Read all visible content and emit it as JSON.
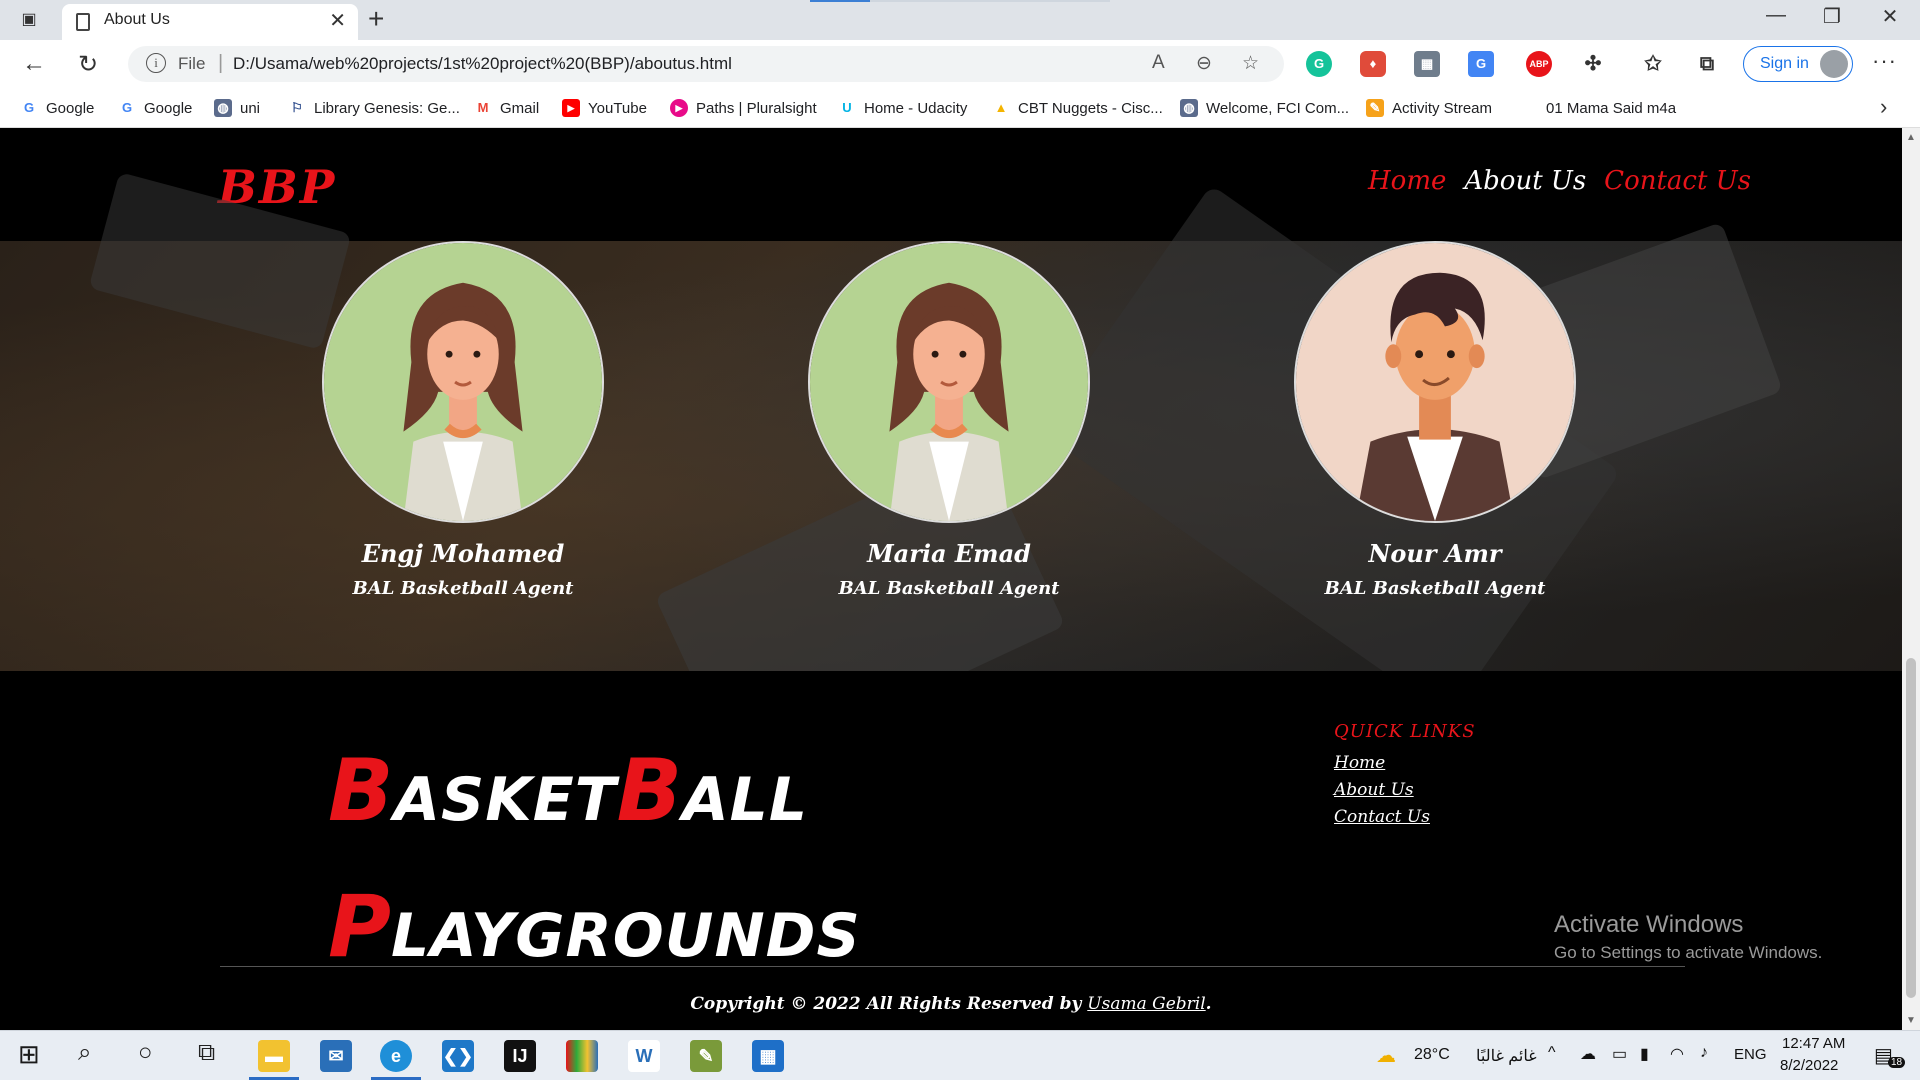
{
  "browser": {
    "tab_title": "About Us",
    "url_scheme_label": "File",
    "url": "D:/Usama/web%20projects/1st%20project%20(BBP)/aboutus.html",
    "signin_label": "Sign in",
    "bookmarks": [
      {
        "label": "Google",
        "icon": "google-icon",
        "color": "#4285f4"
      },
      {
        "label": "Google",
        "icon": "google-icon",
        "color": "#4285f4"
      },
      {
        "label": "uni",
        "icon": "globe-icon",
        "color": "#5b6b8c"
      },
      {
        "label": "Library Genesis: Ge...",
        "icon": "library-icon",
        "color": "#2b4a8b"
      },
      {
        "label": "Gmail",
        "icon": "gmail-icon",
        "color": "#ea4335"
      },
      {
        "label": "YouTube",
        "icon": "youtube-icon",
        "color": "#ff0000"
      },
      {
        "label": "Paths | Pluralsight",
        "icon": "pluralsight-icon",
        "color": "#e80a89"
      },
      {
        "label": "Home - Udacity",
        "icon": "udacity-icon",
        "color": "#02b3e4"
      },
      {
        "label": "CBT Nuggets - Cisc...",
        "icon": "drive-icon",
        "color": "#f4b400"
      },
      {
        "label": "Welcome, FCI Com...",
        "icon": "globe-icon",
        "color": "#5b6b8c"
      },
      {
        "label": "Activity Stream",
        "icon": "pencil-icon",
        "color": "#f6a21a"
      },
      {
        "label": "01 Mama Said m4a",
        "icon": "",
        "color": ""
      }
    ]
  },
  "site": {
    "logo": "BBP",
    "nav": [
      {
        "label": "Home",
        "active": false
      },
      {
        "label": "About Us",
        "active": true
      },
      {
        "label": "Contact Us",
        "active": false
      }
    ],
    "team": [
      {
        "name": "Engj Mohamed",
        "role": "BAL Basketball Agent",
        "avatar": "female"
      },
      {
        "name": "Maria Emad",
        "role": "BAL Basketball Agent",
        "avatar": "female"
      },
      {
        "name": "Nour Amr",
        "role": "BAL Basketball Agent",
        "avatar": "male"
      }
    ],
    "footer": {
      "brand_line1_initial1": "B",
      "brand_line1_part1": "ASKET",
      "brand_line1_initial2": "B",
      "brand_line1_part2": "ALL",
      "brand_line2_initial": "P",
      "brand_line2_part": "LAYGROUNDS",
      "quick_links_title": "QUICK LINKS",
      "quick_links": [
        "Home",
        "About Us",
        "Contact Us"
      ],
      "copyright_prefix": "Copyright © 2022 All Rights Reserved by ",
      "copyright_author": "Usama Gebril",
      "copyright_suffix": "."
    },
    "watermark": {
      "title": "Activate Windows",
      "subtitle": "Go to Settings to activate Windows."
    }
  },
  "taskbar": {
    "temperature": "28°C",
    "weather": "غائم غالبًا",
    "language": "ENG",
    "time": "12:47 AM",
    "date": "8/2/2022",
    "notifications": "18"
  },
  "colors": {
    "accent_red": "#e8141a",
    "avatar_green": "#b5d392",
    "avatar_peach": "#f1d6c7"
  }
}
